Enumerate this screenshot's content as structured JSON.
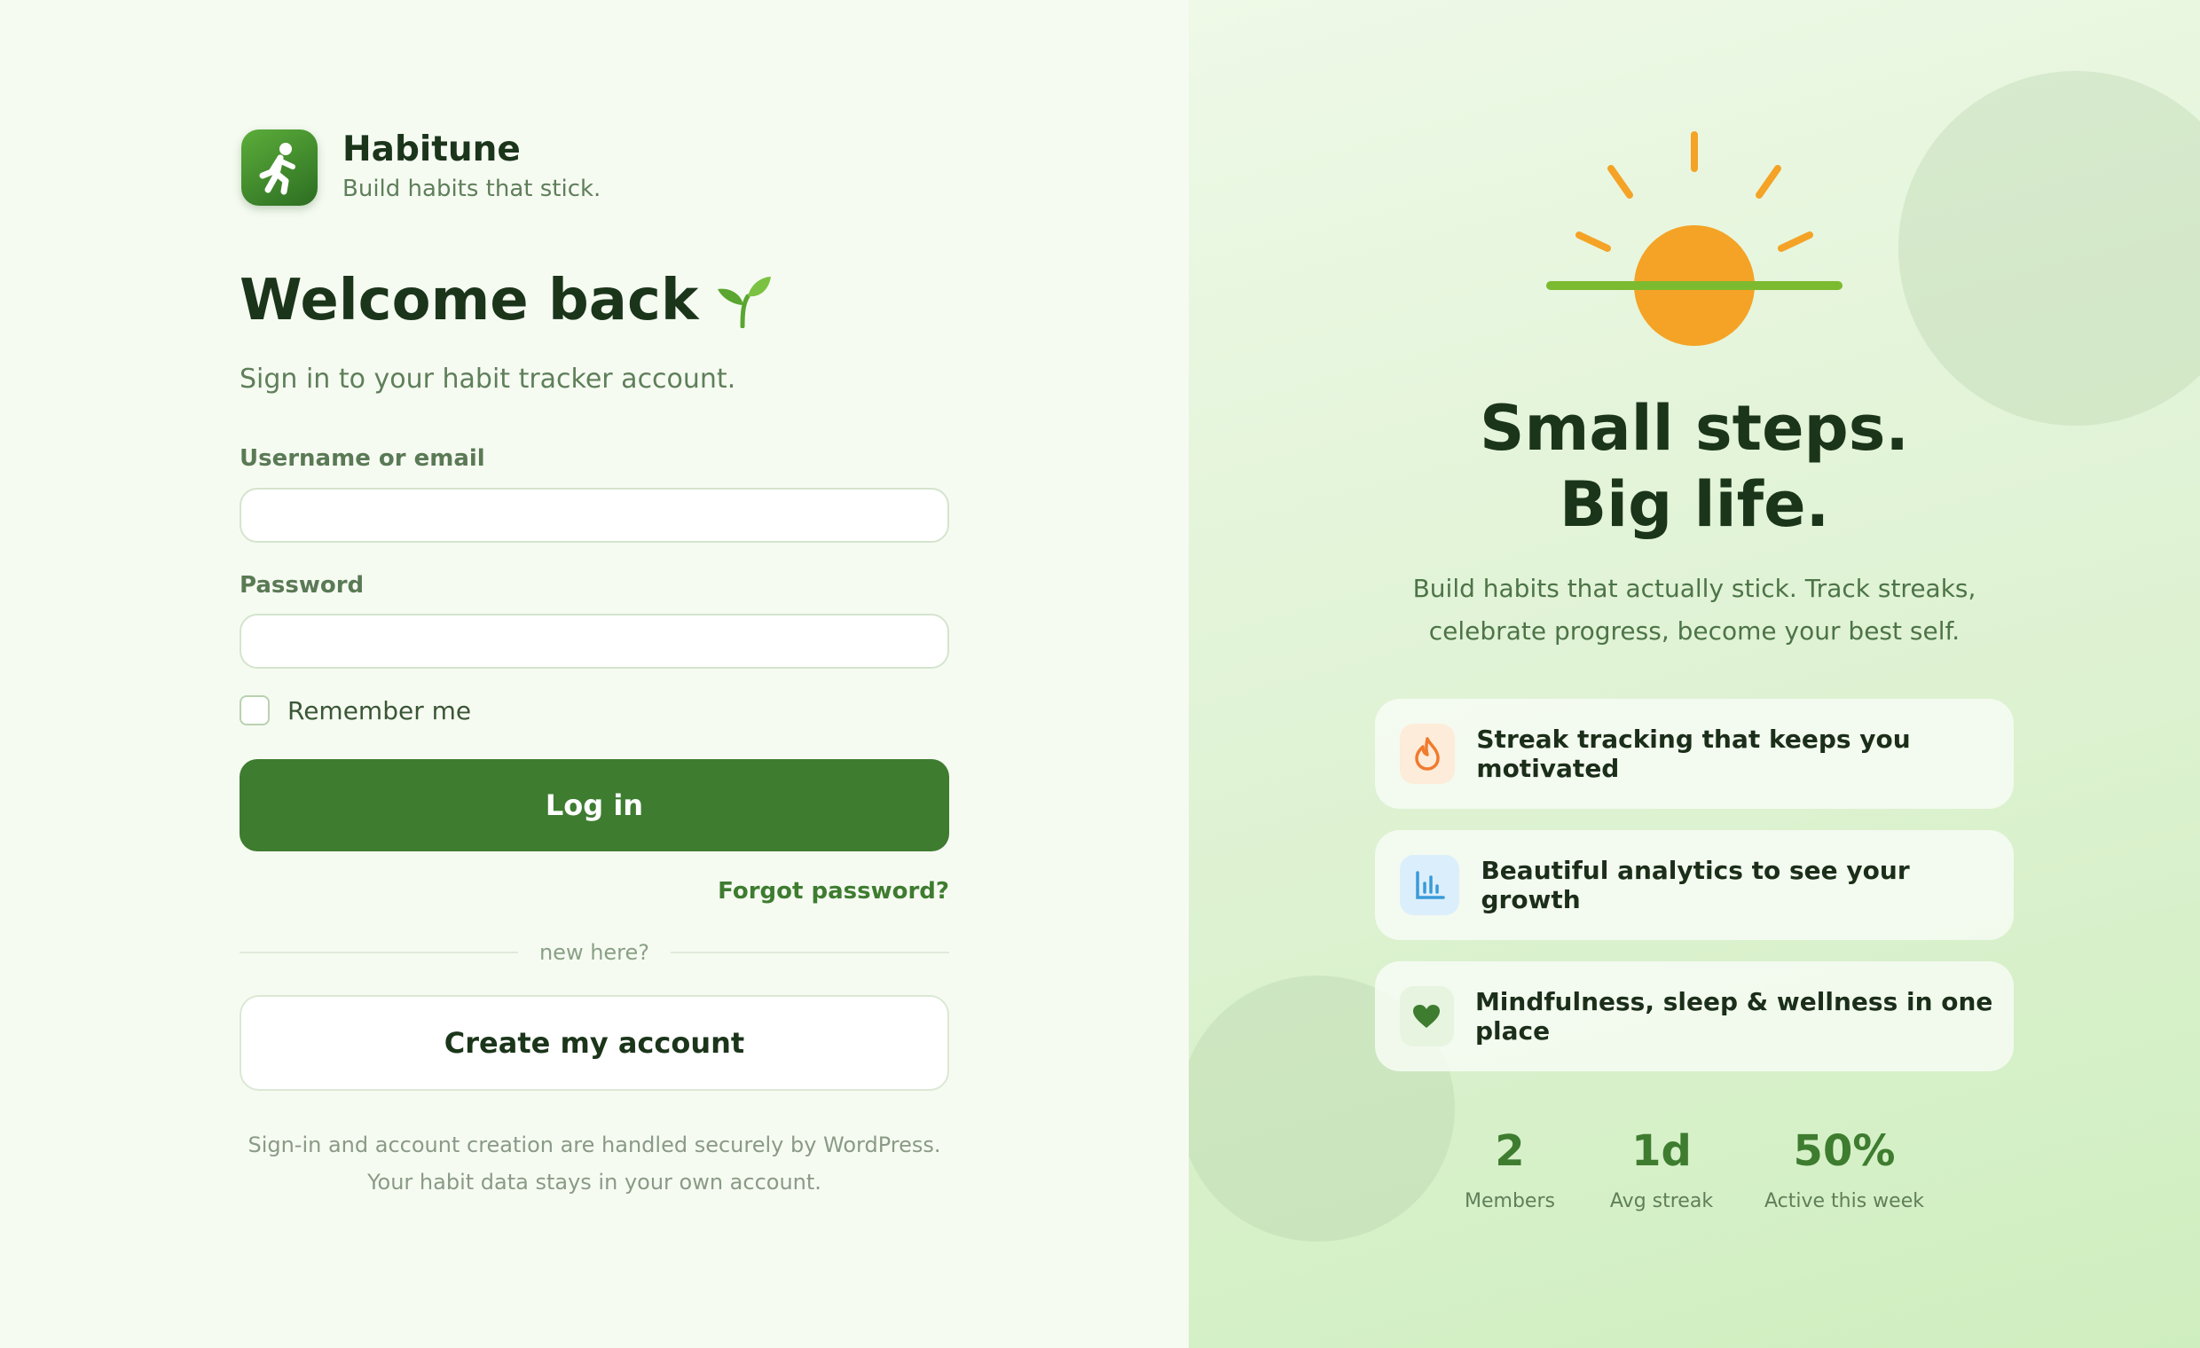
{
  "brand": {
    "name": "Habitune",
    "tagline": "Build habits that stick."
  },
  "login": {
    "heading": "Welcome back",
    "subtitle": "Sign in to your habit tracker account.",
    "username_label": "Username or email",
    "username_value": "",
    "password_label": "Password",
    "password_value": "",
    "remember_label": "Remember me",
    "login_button": "Log in",
    "forgot_link": "Forgot password?",
    "divider_text": "new here?",
    "create_button": "Create my account",
    "footnote": "Sign-in and account creation are handled securely by WordPress. Your habit data stays in your own account."
  },
  "promo": {
    "headline_line1": "Small steps.",
    "headline_line2": "Big life.",
    "subtext_line1": "Build habits that actually stick. Track streaks,",
    "subtext_line2": "celebrate progress, become your best self.",
    "features": [
      {
        "icon": "flame-icon",
        "label": "Streak tracking that keeps you motivated"
      },
      {
        "icon": "bar-chart-icon",
        "label": "Beautiful analytics to see your growth"
      },
      {
        "icon": "heart-icon",
        "label": "Mindfulness, sleep & wellness in one place"
      }
    ],
    "stats": [
      {
        "value": "2",
        "label": "Members"
      },
      {
        "value": "1d",
        "label": "Avg streak"
      },
      {
        "value": "50%",
        "label": "Active this week"
      }
    ]
  },
  "colors": {
    "primary": "#3e7c30",
    "sun": "#f4a326",
    "horizon": "#7cba2f",
    "flame": "#f07a2e",
    "chart": "#3a9ad9"
  }
}
